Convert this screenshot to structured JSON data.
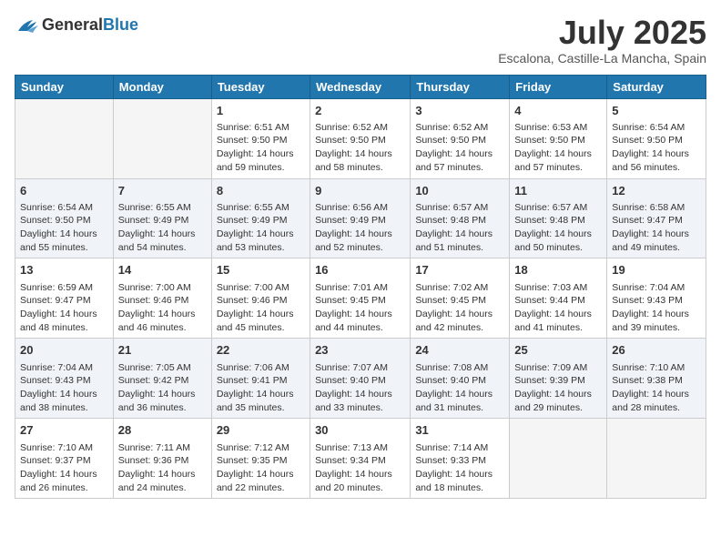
{
  "header": {
    "logo_general": "General",
    "logo_blue": "Blue",
    "month": "July 2025",
    "location": "Escalona, Castille-La Mancha, Spain"
  },
  "weekdays": [
    "Sunday",
    "Monday",
    "Tuesday",
    "Wednesday",
    "Thursday",
    "Friday",
    "Saturday"
  ],
  "weeks": [
    [
      {
        "day": "",
        "sunrise": "",
        "sunset": "",
        "daylight": "",
        "empty": true
      },
      {
        "day": "",
        "sunrise": "",
        "sunset": "",
        "daylight": "",
        "empty": true
      },
      {
        "day": "1",
        "sunrise": "Sunrise: 6:51 AM",
        "sunset": "Sunset: 9:50 PM",
        "daylight": "Daylight: 14 hours and 59 minutes.",
        "empty": false
      },
      {
        "day": "2",
        "sunrise": "Sunrise: 6:52 AM",
        "sunset": "Sunset: 9:50 PM",
        "daylight": "Daylight: 14 hours and 58 minutes.",
        "empty": false
      },
      {
        "day": "3",
        "sunrise": "Sunrise: 6:52 AM",
        "sunset": "Sunset: 9:50 PM",
        "daylight": "Daylight: 14 hours and 57 minutes.",
        "empty": false
      },
      {
        "day": "4",
        "sunrise": "Sunrise: 6:53 AM",
        "sunset": "Sunset: 9:50 PM",
        "daylight": "Daylight: 14 hours and 57 minutes.",
        "empty": false
      },
      {
        "day": "5",
        "sunrise": "Sunrise: 6:54 AM",
        "sunset": "Sunset: 9:50 PM",
        "daylight": "Daylight: 14 hours and 56 minutes.",
        "empty": false
      }
    ],
    [
      {
        "day": "6",
        "sunrise": "Sunrise: 6:54 AM",
        "sunset": "Sunset: 9:50 PM",
        "daylight": "Daylight: 14 hours and 55 minutes.",
        "empty": false
      },
      {
        "day": "7",
        "sunrise": "Sunrise: 6:55 AM",
        "sunset": "Sunset: 9:49 PM",
        "daylight": "Daylight: 14 hours and 54 minutes.",
        "empty": false
      },
      {
        "day": "8",
        "sunrise": "Sunrise: 6:55 AM",
        "sunset": "Sunset: 9:49 PM",
        "daylight": "Daylight: 14 hours and 53 minutes.",
        "empty": false
      },
      {
        "day": "9",
        "sunrise": "Sunrise: 6:56 AM",
        "sunset": "Sunset: 9:49 PM",
        "daylight": "Daylight: 14 hours and 52 minutes.",
        "empty": false
      },
      {
        "day": "10",
        "sunrise": "Sunrise: 6:57 AM",
        "sunset": "Sunset: 9:48 PM",
        "daylight": "Daylight: 14 hours and 51 minutes.",
        "empty": false
      },
      {
        "day": "11",
        "sunrise": "Sunrise: 6:57 AM",
        "sunset": "Sunset: 9:48 PM",
        "daylight": "Daylight: 14 hours and 50 minutes.",
        "empty": false
      },
      {
        "day": "12",
        "sunrise": "Sunrise: 6:58 AM",
        "sunset": "Sunset: 9:47 PM",
        "daylight": "Daylight: 14 hours and 49 minutes.",
        "empty": false
      }
    ],
    [
      {
        "day": "13",
        "sunrise": "Sunrise: 6:59 AM",
        "sunset": "Sunset: 9:47 PM",
        "daylight": "Daylight: 14 hours and 48 minutes.",
        "empty": false
      },
      {
        "day": "14",
        "sunrise": "Sunrise: 7:00 AM",
        "sunset": "Sunset: 9:46 PM",
        "daylight": "Daylight: 14 hours and 46 minutes.",
        "empty": false
      },
      {
        "day": "15",
        "sunrise": "Sunrise: 7:00 AM",
        "sunset": "Sunset: 9:46 PM",
        "daylight": "Daylight: 14 hours and 45 minutes.",
        "empty": false
      },
      {
        "day": "16",
        "sunrise": "Sunrise: 7:01 AM",
        "sunset": "Sunset: 9:45 PM",
        "daylight": "Daylight: 14 hours and 44 minutes.",
        "empty": false
      },
      {
        "day": "17",
        "sunrise": "Sunrise: 7:02 AM",
        "sunset": "Sunset: 9:45 PM",
        "daylight": "Daylight: 14 hours and 42 minutes.",
        "empty": false
      },
      {
        "day": "18",
        "sunrise": "Sunrise: 7:03 AM",
        "sunset": "Sunset: 9:44 PM",
        "daylight": "Daylight: 14 hours and 41 minutes.",
        "empty": false
      },
      {
        "day": "19",
        "sunrise": "Sunrise: 7:04 AM",
        "sunset": "Sunset: 9:43 PM",
        "daylight": "Daylight: 14 hours and 39 minutes.",
        "empty": false
      }
    ],
    [
      {
        "day": "20",
        "sunrise": "Sunrise: 7:04 AM",
        "sunset": "Sunset: 9:43 PM",
        "daylight": "Daylight: 14 hours and 38 minutes.",
        "empty": false
      },
      {
        "day": "21",
        "sunrise": "Sunrise: 7:05 AM",
        "sunset": "Sunset: 9:42 PM",
        "daylight": "Daylight: 14 hours and 36 minutes.",
        "empty": false
      },
      {
        "day": "22",
        "sunrise": "Sunrise: 7:06 AM",
        "sunset": "Sunset: 9:41 PM",
        "daylight": "Daylight: 14 hours and 35 minutes.",
        "empty": false
      },
      {
        "day": "23",
        "sunrise": "Sunrise: 7:07 AM",
        "sunset": "Sunset: 9:40 PM",
        "daylight": "Daylight: 14 hours and 33 minutes.",
        "empty": false
      },
      {
        "day": "24",
        "sunrise": "Sunrise: 7:08 AM",
        "sunset": "Sunset: 9:40 PM",
        "daylight": "Daylight: 14 hours and 31 minutes.",
        "empty": false
      },
      {
        "day": "25",
        "sunrise": "Sunrise: 7:09 AM",
        "sunset": "Sunset: 9:39 PM",
        "daylight": "Daylight: 14 hours and 29 minutes.",
        "empty": false
      },
      {
        "day": "26",
        "sunrise": "Sunrise: 7:10 AM",
        "sunset": "Sunset: 9:38 PM",
        "daylight": "Daylight: 14 hours and 28 minutes.",
        "empty": false
      }
    ],
    [
      {
        "day": "27",
        "sunrise": "Sunrise: 7:10 AM",
        "sunset": "Sunset: 9:37 PM",
        "daylight": "Daylight: 14 hours and 26 minutes.",
        "empty": false
      },
      {
        "day": "28",
        "sunrise": "Sunrise: 7:11 AM",
        "sunset": "Sunset: 9:36 PM",
        "daylight": "Daylight: 14 hours and 24 minutes.",
        "empty": false
      },
      {
        "day": "29",
        "sunrise": "Sunrise: 7:12 AM",
        "sunset": "Sunset: 9:35 PM",
        "daylight": "Daylight: 14 hours and 22 minutes.",
        "empty": false
      },
      {
        "day": "30",
        "sunrise": "Sunrise: 7:13 AM",
        "sunset": "Sunset: 9:34 PM",
        "daylight": "Daylight: 14 hours and 20 minutes.",
        "empty": false
      },
      {
        "day": "31",
        "sunrise": "Sunrise: 7:14 AM",
        "sunset": "Sunset: 9:33 PM",
        "daylight": "Daylight: 14 hours and 18 minutes.",
        "empty": false
      },
      {
        "day": "",
        "sunrise": "",
        "sunset": "",
        "daylight": "",
        "empty": true
      },
      {
        "day": "",
        "sunrise": "",
        "sunset": "",
        "daylight": "",
        "empty": true
      }
    ]
  ]
}
